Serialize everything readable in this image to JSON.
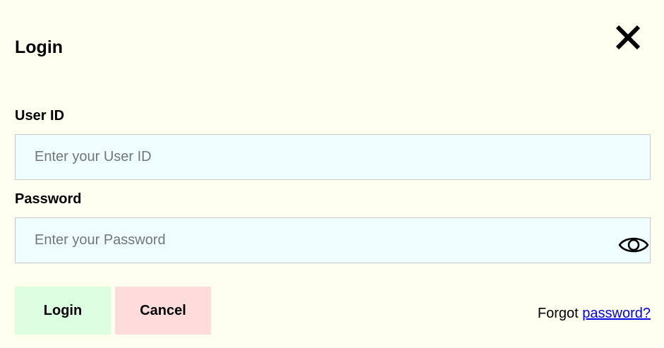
{
  "dialog": {
    "title": "Login",
    "close_icon": "close-icon"
  },
  "form": {
    "user_id": {
      "label": "User ID",
      "value": "",
      "placeholder": "Enter your User ID"
    },
    "password": {
      "label": "Password",
      "value": "",
      "placeholder": "Enter your Password",
      "toggle_icon": "eye-icon"
    }
  },
  "actions": {
    "login_label": "Login",
    "cancel_label": "Cancel",
    "login_color": "#ddfde0",
    "cancel_color": "#ffdcdc"
  },
  "forgot": {
    "prefix": "Forgot ",
    "link_text": "password?"
  },
  "colors": {
    "background": "#fffff0",
    "input_background": "#eefeff",
    "link": "#0000ee"
  }
}
